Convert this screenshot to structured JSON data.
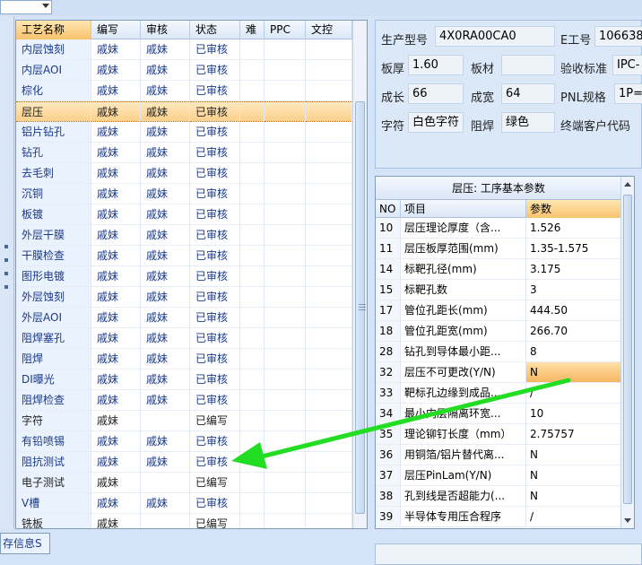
{
  "left_grid": {
    "columns": [
      "工艺名称",
      "编写",
      "审核",
      "状态",
      "难",
      "PPC",
      "文控"
    ],
    "rows": [
      {
        "name": "内层蚀刻",
        "writer": "戚妹",
        "reviewer": "戚妹",
        "status": "已审核"
      },
      {
        "name": "内层AOI",
        "writer": "戚妹",
        "reviewer": "戚妹",
        "status": "已审核"
      },
      {
        "name": "棕化",
        "writer": "戚妹",
        "reviewer": "戚妹",
        "status": "已审核"
      },
      {
        "name": "层压",
        "writer": "戚妹",
        "reviewer": "戚妹",
        "status": "已审核",
        "selected": true
      },
      {
        "name": "铝片钻孔",
        "writer": "戚妹",
        "reviewer": "戚妹",
        "status": "已审核"
      },
      {
        "name": "钻孔",
        "writer": "戚妹",
        "reviewer": "戚妹",
        "status": "已审核"
      },
      {
        "name": "去毛刺",
        "writer": "戚妹",
        "reviewer": "戚妹",
        "status": "已审核"
      },
      {
        "name": "沉铜",
        "writer": "戚妹",
        "reviewer": "戚妹",
        "status": "已审核"
      },
      {
        "name": "板镀",
        "writer": "戚妹",
        "reviewer": "戚妹",
        "status": "已审核"
      },
      {
        "name": "外层干膜",
        "writer": "戚妹",
        "reviewer": "戚妹",
        "status": "已审核"
      },
      {
        "name": "干膜检查",
        "writer": "戚妹",
        "reviewer": "戚妹",
        "status": "已审核"
      },
      {
        "name": "图形电镀",
        "writer": "戚妹",
        "reviewer": "戚妹",
        "status": "已审核"
      },
      {
        "name": "外层蚀刻",
        "writer": "戚妹",
        "reviewer": "戚妹",
        "status": "已审核"
      },
      {
        "name": "外层AOI",
        "writer": "戚妹",
        "reviewer": "戚妹",
        "status": "已审核"
      },
      {
        "name": "阻焊塞孔",
        "writer": "戚妹",
        "reviewer": "戚妹",
        "status": "已审核"
      },
      {
        "name": "阻焊",
        "writer": "戚妹",
        "reviewer": "戚妹",
        "status": "已审核"
      },
      {
        "name": "DI曝光",
        "writer": "戚妹",
        "reviewer": "戚妹",
        "status": "已审核"
      },
      {
        "name": "阻焊检查",
        "writer": "戚妹",
        "reviewer": "戚妹",
        "status": "已审核"
      },
      {
        "name": "字符",
        "writer": "戚妹",
        "reviewer": "",
        "status": "已编写",
        "plain": true
      },
      {
        "name": "有铅喷锡",
        "writer": "戚妹",
        "reviewer": "戚妹",
        "status": "已审核"
      },
      {
        "name": "阻抗测试",
        "writer": "戚妹",
        "reviewer": "戚妹",
        "status": "已审核"
      },
      {
        "name": "电子测试",
        "writer": "戚妹",
        "reviewer": "",
        "status": "已编写",
        "plain": true
      },
      {
        "name": "V槽",
        "writer": "戚妹",
        "reviewer": "戚妹",
        "status": "已审核"
      },
      {
        "name": "铣板",
        "writer": "戚妹",
        "reviewer": "",
        "status": "已编写",
        "plain": true
      }
    ]
  },
  "bottom_tab": {
    "label": "存信息S"
  },
  "info_panel": {
    "model_label": "生产型号",
    "model_value": "4X0RA00CA0",
    "e_label": "E工号",
    "e_value": "106638",
    "thickness_label": "板厚",
    "thickness_value": "1.60",
    "material_label": "板材",
    "material_value": "",
    "accept_label": "验收标准",
    "accept_value": "IPC-",
    "length_label": "成长",
    "length_value": "66",
    "width_label": "成宽",
    "width_value": "64",
    "pnl_label": "PNL规格",
    "pnl_value": "1P=",
    "char_label": "字符",
    "char_value": "白色字符",
    "mask_label": "阻焊",
    "mask_value": "绿色",
    "customer_label": "终端客户代码"
  },
  "param_grid": {
    "title": "层压: 工序基本参数",
    "columns": [
      "NO",
      "项目",
      "参数"
    ],
    "rows": [
      {
        "no": "10",
        "item": "层压理论厚度（含...",
        "value": "1.526"
      },
      {
        "no": "11",
        "item": "层压板厚范围(mm)",
        "value": "1.35-1.575"
      },
      {
        "no": "14",
        "item": "标靶孔径(mm)",
        "value": "3.175"
      },
      {
        "no": "15",
        "item": "标靶孔数",
        "value": "3"
      },
      {
        "no": "17",
        "item": "管位孔距长(mm)",
        "value": "444.50"
      },
      {
        "no": "18",
        "item": "管位孔距宽(mm)",
        "value": "266.70"
      },
      {
        "no": "28",
        "item": "钻孔到导体最小距...",
        "value": "8"
      },
      {
        "no": "32",
        "item": "层压不可更改(Y/N)",
        "value": "N",
        "highlight": true
      },
      {
        "no": "33",
        "item": "靶标孔边缘到成品...",
        "value": "/"
      },
      {
        "no": "34",
        "item": "最小内层隔离环宽...",
        "value": "10"
      },
      {
        "no": "35",
        "item": "理论铆钉长度（mm）",
        "value": "2.75757"
      },
      {
        "no": "36",
        "item": "用铜箔/铝片替代离...",
        "value": "N"
      },
      {
        "no": "37",
        "item": "层压PinLam(Y/N)",
        "value": "N"
      },
      {
        "no": "38",
        "item": "孔到线是否超能力(...",
        "value": "N"
      },
      {
        "no": "39",
        "item": "半导体专用压合程序",
        "value": "/"
      }
    ]
  },
  "annotation": {
    "arrow_color": "#22dd22"
  }
}
